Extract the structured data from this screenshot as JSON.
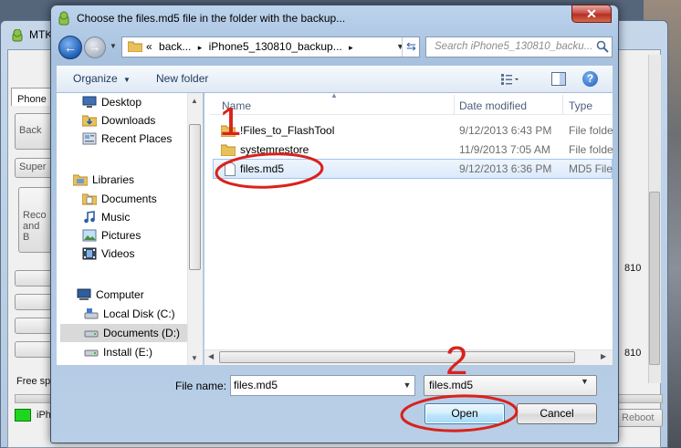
{
  "background_app": {
    "title": "MTK",
    "tab_label": "Phone",
    "left_buttons": [
      "Back",
      "Super",
      "Reco and B"
    ],
    "right_values": [
      "810",
      "810"
    ],
    "free_space_label": "Free sp",
    "status_label": "iPh",
    "reboot_label": "Reboot"
  },
  "dialog": {
    "title": "Choose the files.md5 file in the folder with the backup...",
    "close_label": "✕",
    "address": {
      "prefix": "«",
      "crumbs": [
        "back...",
        "iPhone5_130810_backup..."
      ],
      "separator": "▸"
    },
    "search": {
      "placeholder": "Search iPhone5_130810_backu..."
    },
    "toolbar": {
      "organize_label": "Organize",
      "new_folder_label": "New folder",
      "help_label": "?"
    },
    "nav_pane": {
      "favorites": [
        {
          "label": "Desktop",
          "icon": "desktop-icon"
        },
        {
          "label": "Downloads",
          "icon": "downloads-folder-icon"
        },
        {
          "label": "Recent Places",
          "icon": "recent-places-icon"
        }
      ],
      "libraries_label": "Libraries",
      "libraries": [
        {
          "label": "Documents",
          "icon": "documents-icon"
        },
        {
          "label": "Music",
          "icon": "music-icon"
        },
        {
          "label": "Pictures",
          "icon": "pictures-icon"
        },
        {
          "label": "Videos",
          "icon": "videos-icon"
        }
      ],
      "computer_label": "Computer",
      "drives": [
        {
          "label": "Local Disk (C:)",
          "icon": "local-disk-icon",
          "selected": false
        },
        {
          "label": "Documents (D:)",
          "icon": "drive-icon",
          "selected": true
        },
        {
          "label": "Install (E:)",
          "icon": "drive-icon",
          "selected": false
        }
      ]
    },
    "columns": [
      "Name",
      "Date modified",
      "Type"
    ],
    "files": [
      {
        "name": "!Files_to_FlashTool",
        "date": "9/12/2013 6:43 PM",
        "type": "File folde",
        "kind": "folder",
        "selected": false
      },
      {
        "name": "systemrestore",
        "date": "11/9/2013 7:05 AM",
        "type": "File folde",
        "kind": "folder",
        "selected": false
      },
      {
        "name": "files.md5",
        "date": "9/12/2013 6:36 PM",
        "type": "MD5 File",
        "kind": "file",
        "selected": true
      }
    ],
    "file_name_label": "File name:",
    "file_name_value": "files.md5",
    "file_type_value": "files.md5",
    "open_label": "Open",
    "cancel_label": "Cancel"
  },
  "annotations": {
    "step1": "1",
    "step2": "2",
    "color": "#d9221b"
  }
}
